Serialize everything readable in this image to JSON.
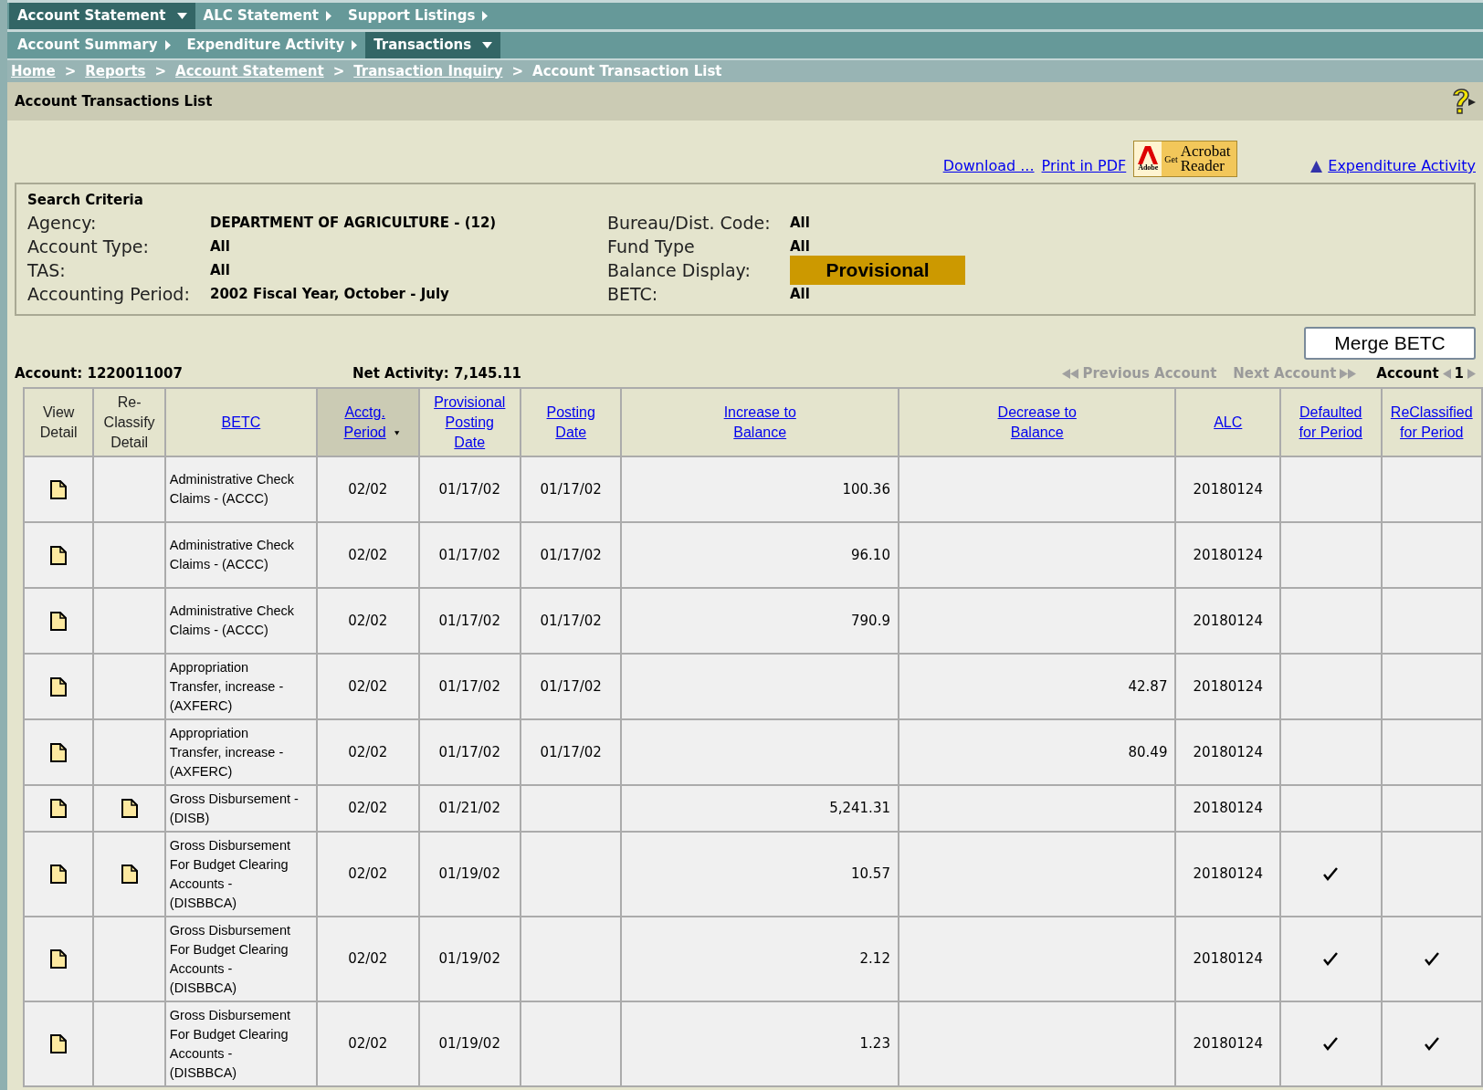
{
  "menu_rows": [
    [
      {
        "label": "Account Statement",
        "selected": true
      },
      {
        "label": "ALC Statement",
        "selected": false
      },
      {
        "label": "Support Listings",
        "selected": false
      }
    ],
    [
      {
        "label": "Account Summary",
        "selected": false
      },
      {
        "label": "Expenditure Activity",
        "selected": false
      },
      {
        "label": "Transactions",
        "selected": true
      }
    ]
  ],
  "breadcrumb": {
    "links": [
      "Home",
      "Reports",
      "Account Statement",
      "Transaction Inquiry"
    ],
    "separators": [
      ">",
      ">",
      ">",
      ">"
    ],
    "current": "Account Transaction List"
  },
  "page_title": "Account Transactions List",
  "actions": {
    "download": "Download ...",
    "print": "Print in PDF",
    "acrobat_get": "Get",
    "acrobat_name": "Acrobat",
    "acrobat_reader": "Reader",
    "acrobat_adobe": "Adobe",
    "expenditure": "Expenditure Activity"
  },
  "search_criteria": {
    "title": "Search Criteria",
    "left": [
      {
        "label": "Agency:",
        "value": "DEPARTMENT OF AGRICULTURE - (12)"
      },
      {
        "label": "Account Type:",
        "value": "All"
      },
      {
        "label": "TAS:",
        "value": "All"
      },
      {
        "label": "Accounting Period:",
        "value": "2002 Fiscal Year, October - July"
      }
    ],
    "right": [
      {
        "label": "Bureau/Dist. Code:",
        "value": "All",
        "kind": "plain"
      },
      {
        "label": "Fund Type",
        "value": "All",
        "kind": "plain"
      },
      {
        "label": "Balance Display:",
        "value": "Provisional",
        "kind": "highlight"
      },
      {
        "label": "BETC:",
        "value": "All",
        "kind": "plain"
      }
    ]
  },
  "merge_button": "Merge BETC",
  "account": "Account: 1220011007",
  "net_activity": "Net Activity: 7,145.11",
  "nav": {
    "previous": "Previous Account",
    "next": "Next Account",
    "account_label": "Account",
    "account_number": "1",
    "disabled": true
  },
  "table": {
    "columns": [
      {
        "label": "View Detail",
        "kind": "plain",
        "sorted": false
      },
      {
        "label": "Re-Classify Detail",
        "kind": "plain",
        "sorted": false
      },
      {
        "label": "BETC",
        "kind": "link",
        "sorted": false
      },
      {
        "label": "Acctg. Period",
        "kind": "link",
        "sorted": true
      },
      {
        "label": "Provisional Posting Date",
        "kind": "link",
        "sorted": false
      },
      {
        "label": "Posting Date",
        "kind": "link",
        "sorted": false
      },
      {
        "label": "Increase to Balance",
        "kind": "link",
        "sorted": false
      },
      {
        "label": "Decrease to Balance",
        "kind": "link",
        "sorted": false
      },
      {
        "label": "ALC",
        "kind": "link",
        "sorted": false
      },
      {
        "label": "Defaulted for Period",
        "kind": "link",
        "sorted": false
      },
      {
        "label": "ReClassified for Period",
        "kind": "link",
        "sorted": false
      }
    ],
    "rows": [
      {
        "view": true,
        "reclassify": false,
        "betc": "Administrative Check Claims - (ACCC)",
        "period": "02/02",
        "provisional_date": "01/17/02",
        "posting_date": "01/17/02",
        "increase": "100.36",
        "decrease": "",
        "alc": "20180124",
        "defaulted": false,
        "reclassified": false
      },
      {
        "view": true,
        "reclassify": false,
        "betc": "Administrative Check Claims - (ACCC)",
        "period": "02/02",
        "provisional_date": "01/17/02",
        "posting_date": "01/17/02",
        "increase": "96.10",
        "decrease": "",
        "alc": "20180124",
        "defaulted": false,
        "reclassified": false
      },
      {
        "view": true,
        "reclassify": false,
        "betc": "Administrative Check Claims - (ACCC)",
        "period": "02/02",
        "provisional_date": "01/17/02",
        "posting_date": "01/17/02",
        "increase": "790.9",
        "decrease": "",
        "alc": "20180124",
        "defaulted": false,
        "reclassified": false
      },
      {
        "view": true,
        "reclassify": false,
        "betc": "Appropriation Transfer, increase - (AXFERC)",
        "period": "02/02",
        "provisional_date": "01/17/02",
        "posting_date": "01/17/02",
        "increase": "",
        "decrease": "42.87",
        "alc": "20180124",
        "defaulted": false,
        "reclassified": false
      },
      {
        "view": true,
        "reclassify": false,
        "betc": "Appropriation Transfer, increase - (AXFERC)",
        "period": "02/02",
        "provisional_date": "01/17/02",
        "posting_date": "01/17/02",
        "increase": "",
        "decrease": "80.49",
        "alc": "20180124",
        "defaulted": false,
        "reclassified": false
      },
      {
        "view": true,
        "reclassify": true,
        "betc": "Gross Disbursement - (DISB)",
        "period": "02/02",
        "provisional_date": "01/21/02",
        "posting_date": "",
        "increase": "5,241.31",
        "decrease": "",
        "alc": "20180124",
        "defaulted": false,
        "reclassified": false
      },
      {
        "view": true,
        "reclassify": true,
        "betc": "Gross Disbursement For Budget Clearing Accounts - (DISBBCA)",
        "period": "02/02",
        "provisional_date": "01/19/02",
        "posting_date": "",
        "increase": "10.57",
        "decrease": "",
        "alc": "20180124",
        "defaulted": true,
        "reclassified": false
      },
      {
        "view": true,
        "reclassify": false,
        "betc": "Gross Disbursement For Budget Clearing Accounts - (DISBBCA)",
        "period": "02/02",
        "provisional_date": "01/19/02",
        "posting_date": "",
        "increase": "2.12",
        "decrease": "",
        "alc": "20180124",
        "defaulted": true,
        "reclassified": true
      },
      {
        "view": true,
        "reclassify": false,
        "betc": "Gross Disbursement For Budget Clearing Accounts - (DISBBCA)",
        "period": "02/02",
        "provisional_date": "01/19/02",
        "posting_date": "",
        "increase": "1.23",
        "decrease": "",
        "alc": "20180124",
        "defaulted": true,
        "reclassified": true
      }
    ]
  }
}
